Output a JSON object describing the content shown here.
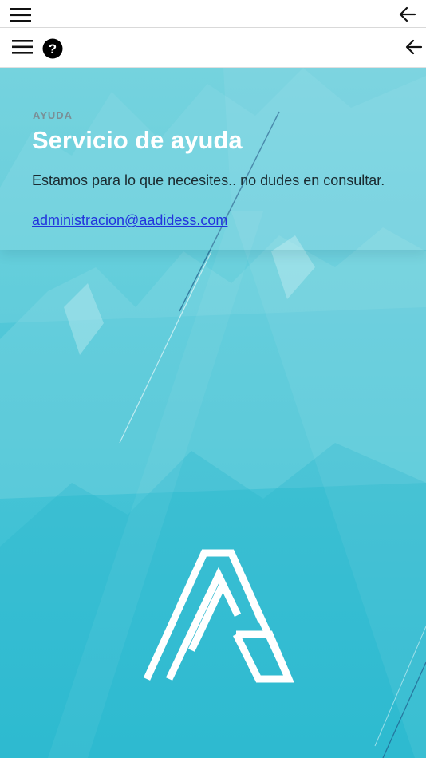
{
  "top_bar": {
    "menu_icon": "hamburger-menu-icon",
    "back_icon": "arrow-left-icon"
  },
  "nav_bar": {
    "menu_icon": "hamburger-menu-icon",
    "help_icon": "question-circle-icon",
    "help_glyph": "?",
    "back_icon": "arrow-left-icon"
  },
  "help_section": {
    "eyebrow": "AYUDA",
    "title": "Servicio de ayuda",
    "description": "Estamos para lo que necesites.. no dudes en consultar.",
    "email": "administracion@aadidess.com",
    "email_href": "mailto:administracion@aadidess.com"
  },
  "colors": {
    "hero_background": "#39bfd3",
    "title": "#ffffff",
    "eyebrow": "#7a8f96",
    "link": "#2233dd"
  },
  "logo": {
    "icon": "aadidess-a-logo"
  }
}
